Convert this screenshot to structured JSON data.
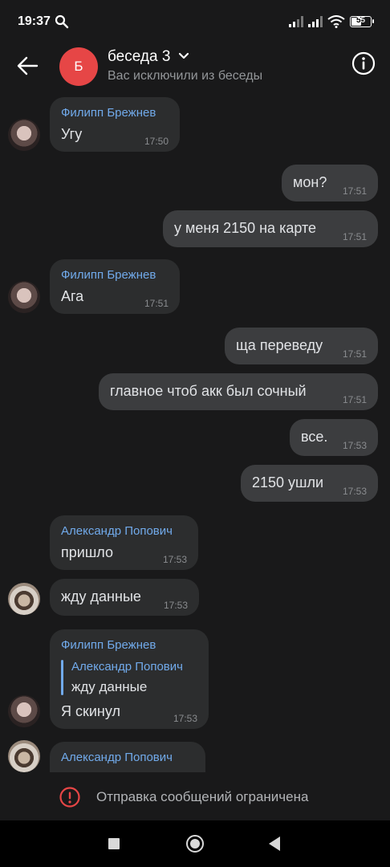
{
  "status_bar": {
    "time": "19:37",
    "battery": "55"
  },
  "header": {
    "title": "беседа 3",
    "subtitle": "Вас исключили из беседы",
    "avatar_letter": "Б",
    "avatar_color": "#e64646"
  },
  "messages": [
    {
      "sender": "Филипп Брежнев",
      "text": "Угу",
      "time": "17:50",
      "direction": "in"
    },
    {
      "text": "мон?",
      "time": "17:51",
      "direction": "out"
    },
    {
      "text": "у меня 2150 на карте",
      "time": "17:51",
      "direction": "out"
    },
    {
      "sender": "Филипп Брежнев",
      "text": "Ага",
      "time": "17:51",
      "direction": "in"
    },
    {
      "text": "ща переведу",
      "time": "17:51",
      "direction": "out"
    },
    {
      "text": "главное чтоб акк был сочный",
      "time": "17:51",
      "direction": "out"
    },
    {
      "text": "все.",
      "time": "17:53",
      "direction": "out"
    },
    {
      "text": "2150 ушли",
      "time": "17:53",
      "direction": "out"
    },
    {
      "sender": "Александр Попович",
      "text": "пришло",
      "time": "17:53",
      "direction": "in"
    },
    {
      "text": "жду данные",
      "time": "17:53",
      "direction": "in"
    },
    {
      "sender": "Филипп Брежнев",
      "reply_sender": "Александр Попович",
      "reply_text": "жду данные",
      "text": "Я скинул",
      "time": "17:53",
      "direction": "in"
    },
    {
      "sender": "Александр Попович",
      "direction": "in"
    }
  ],
  "footer": {
    "restriction_text": "Отправка сообщений ограничена"
  },
  "colors": {
    "background": "#19191a",
    "bubble_in": "#2c2d2e",
    "bubble_out": "#3c3d3f",
    "accent": "#71aaeb",
    "warning": "#e64646"
  }
}
